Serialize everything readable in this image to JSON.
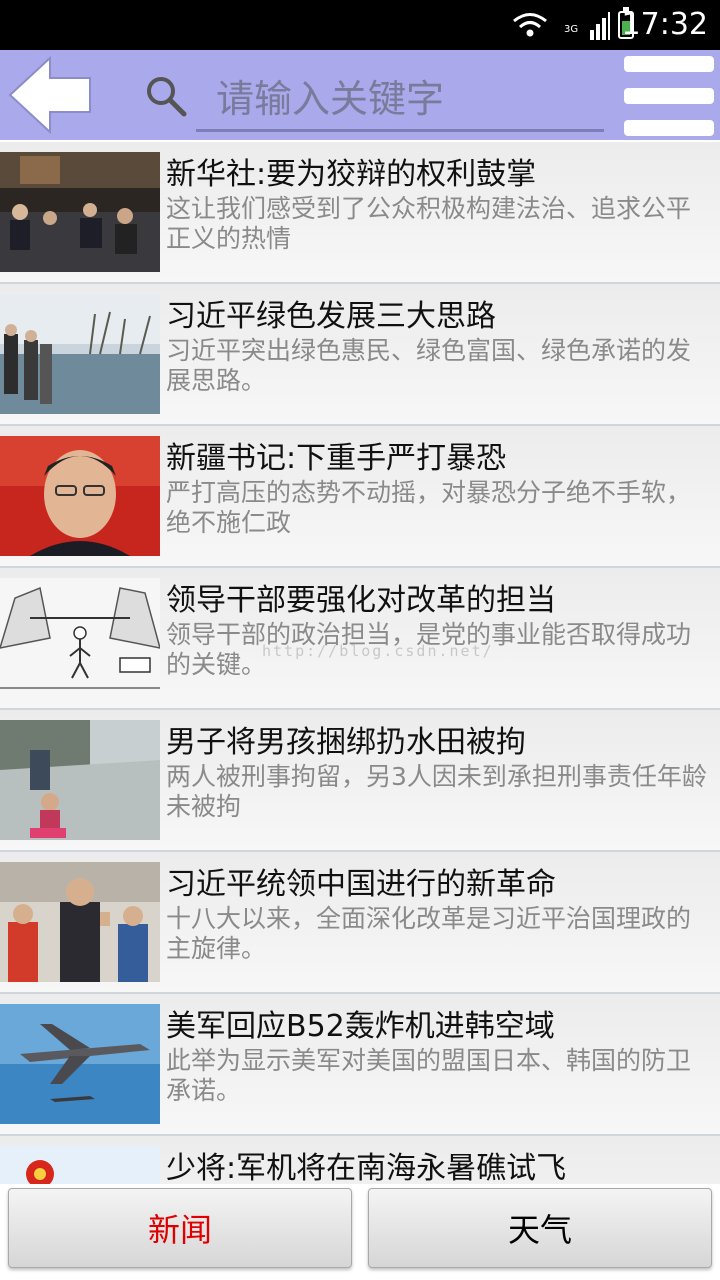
{
  "status_bar": {
    "time": "17:32",
    "network_label": "3G",
    "icons": [
      "wifi-icon",
      "signal-icon",
      "battery-icon"
    ]
  },
  "header": {
    "search_placeholder": "请输入关键字",
    "icons": [
      "back-arrow-icon",
      "search-icon",
      "menu-icon"
    ]
  },
  "news": [
    {
      "title": "新华社:要为狡辩的权利鼓掌",
      "summary": "这让我们感受到了公众积极构建法治、追求公平正义的热情",
      "thumb": "courtroom"
    },
    {
      "title": "习近平绿色发展三大思路",
      "summary": "习近平突出绿色惠民、绿色富国、绿色承诺的发展思路。",
      "thumb": "lakeside"
    },
    {
      "title": "新疆书记:下重手严打暴恐",
      "summary": "严打高压的态势不动摇，对暴恐分子绝不手软，绝不施仁政",
      "thumb": "portrait"
    },
    {
      "title": "领导干部要强化对改革的担当",
      "summary": "领导干部的政治担当，是党的事业能否取得成功的关键。",
      "thumb": "cartoon"
    },
    {
      "title": "男子将男孩捆绑扔水田被拘",
      "summary": "两人被刑事拘留，另3人因未到承担刑事责任年龄未被拘",
      "thumb": "child"
    },
    {
      "title": "习近平统领中国进行的新革命",
      "summary": "十八大以来，全面深化改革是习近平治国理政的主旋律。",
      "thumb": "crowd"
    },
    {
      "title": "美军回应B52轰炸机进韩空域",
      "summary": "此举为显示美军对美国的盟国日本、韩国的防卫承诺。",
      "thumb": "bomber"
    },
    {
      "title": "少将:军机将在南海永暑礁试飞",
      "summary": "",
      "thumb": "flag"
    }
  ],
  "watermark": "http://blog.csdn.net/",
  "bottom_tabs": {
    "news_label": "新闻",
    "weather_label": "天气"
  },
  "colors": {
    "header_bg": "#a9a9ec",
    "active_tab_text": "#e00000"
  }
}
